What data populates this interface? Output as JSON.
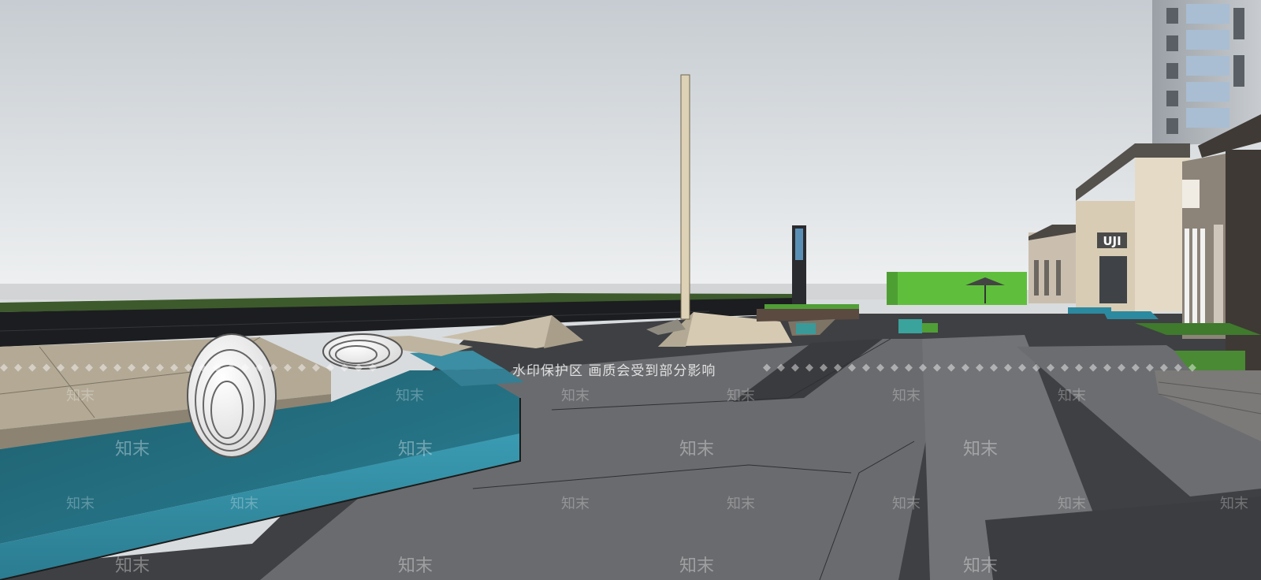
{
  "watermark": {
    "band_text": "水印保护区  画质会受到部分影响",
    "brand_text": "知末"
  },
  "signage": {
    "storefront_sign": "UJI"
  },
  "colors": {
    "sky_top": "#c9ced3",
    "sky_bottom": "#eef0f1",
    "water": "#2f8aa0",
    "paving_dark": "#3e3f42",
    "paving_light": "#6e6f72",
    "stone_beige": "#b5ab97",
    "green_wall": "#5fbf3c"
  }
}
